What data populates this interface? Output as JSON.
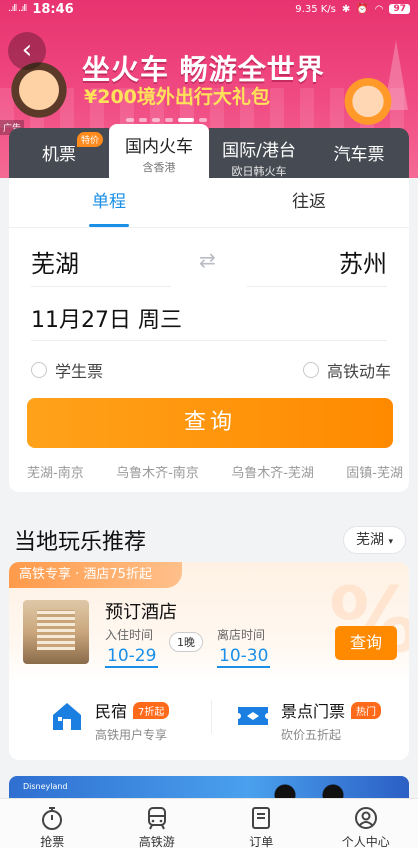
{
  "status_bar": {
    "signal": "..ıll ..ıll",
    "time": "18:46",
    "speed": "9.35 K/s",
    "battery": "97"
  },
  "banner": {
    "title": "坐火车 畅游全世界",
    "subtitle": "¥200境外出行大礼包",
    "ad_label": "广告"
  },
  "tabs": [
    {
      "label": "机票",
      "badge": "特价"
    },
    {
      "label": "国内火车",
      "sub": "含香港"
    },
    {
      "label": "国际/港台",
      "sub": "欧日韩火车"
    },
    {
      "label": "汽车票"
    }
  ],
  "search": {
    "trip_tabs": [
      "单程",
      "往返"
    ],
    "from_city": "芜湖",
    "to_city": "苏州",
    "date": "11月27日 周三",
    "option_student": "学生票",
    "option_highspeed": "高铁动车",
    "button": "查询",
    "history": [
      "芜湖-南京",
      "乌鲁木齐-南京",
      "乌鲁木齐-芜湖",
      "固镇-芜湖"
    ]
  },
  "recommend": {
    "title": "当地玩乐推荐",
    "city": "芜湖",
    "promo": "高铁专享 · 酒店75折起",
    "hotel_title": "预订酒店",
    "checkin_label": "入住时间",
    "checkout_label": "离店时间",
    "checkin": "10-29",
    "checkout": "10-30",
    "nights": "1晚",
    "button": "查询",
    "services": [
      {
        "name": "民宿",
        "tag": "7折起",
        "desc": "高铁用户专享",
        "color": "#1a7fe0"
      },
      {
        "name": "景点门票",
        "tag": "热门",
        "desc": "砍价五折起",
        "color": "#1a7fe0"
      }
    ]
  },
  "ad2_logo": "Disneyland",
  "bottom_nav": [
    {
      "label": "抢票",
      "icon": "stopwatch-icon"
    },
    {
      "label": "高铁游",
      "icon": "train-icon"
    },
    {
      "label": "订单",
      "icon": "order-icon"
    },
    {
      "label": "个人中心",
      "icon": "user-icon"
    }
  ]
}
